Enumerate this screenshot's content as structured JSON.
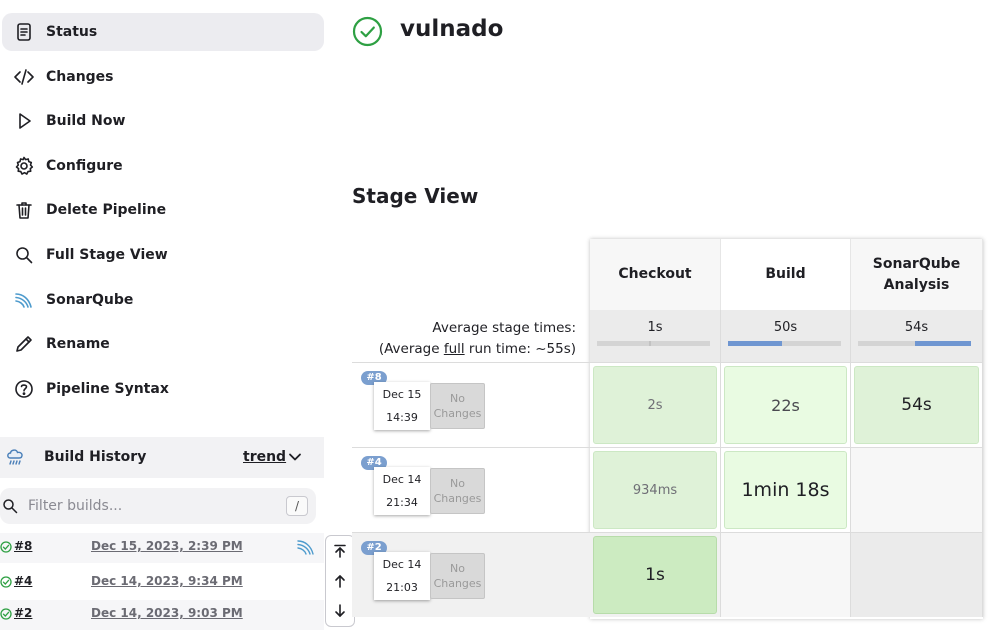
{
  "sidebar": {
    "tasks": [
      {
        "label": "Status",
        "icon": "status-icon",
        "active": true
      },
      {
        "label": "Changes",
        "icon": "code-icon"
      },
      {
        "label": "Build Now",
        "icon": "play-icon"
      },
      {
        "label": "Configure",
        "icon": "gear-icon"
      },
      {
        "label": "Delete Pipeline",
        "icon": "trash-icon"
      },
      {
        "label": "Full Stage View",
        "icon": "search-icon"
      },
      {
        "label": "SonarQube",
        "icon": "sonarqube-icon"
      },
      {
        "label": "Rename",
        "icon": "pencil-icon"
      },
      {
        "label": "Pipeline Syntax",
        "icon": "help-icon"
      }
    ]
  },
  "build_history": {
    "title": "Build History",
    "trend": "trend",
    "filter_placeholder": "Filter builds...",
    "filter_shortcut": "/",
    "builds": [
      {
        "number": "#8",
        "date": "Dec 15, 2023, 2:39 PM",
        "status": "success"
      },
      {
        "number": "#4",
        "date": "Dec 14, 2023, 9:34 PM",
        "status": "success"
      },
      {
        "number": "#2",
        "date": "Dec 14, 2023, 9:03 PM",
        "status": "success"
      }
    ]
  },
  "job": {
    "name": "vulnado",
    "status": "success"
  },
  "stage_view": {
    "title": "Stage View",
    "avg_label": "Average stage times:",
    "avg_full_prefix": "(Average ",
    "avg_full_link": "full",
    "avg_full_suffix": " run time: ~55s)",
    "stages": [
      {
        "name": "Checkout",
        "avg": "1s",
        "avg_fraction": 0.02
      },
      {
        "name": "Build",
        "avg": "50s",
        "avg_fraction": 0.48
      },
      {
        "name": "SonarQube Analysis",
        "avg": "54s",
        "avg_fraction": 0.5
      }
    ],
    "runs": [
      {
        "badge": "#8",
        "date": "Dec 15",
        "time": "14:39",
        "changes": "No Changes",
        "durations": [
          "2s",
          "22s",
          "54s"
        ]
      },
      {
        "badge": "#4",
        "date": "Dec 14",
        "time": "21:34",
        "changes": "No Changes",
        "durations": [
          "934ms",
          "1min 18s",
          ""
        ]
      },
      {
        "badge": "#2",
        "date": "Dec 14",
        "time": "21:03",
        "changes": "No Changes",
        "durations": [
          "1s",
          "",
          ""
        ]
      }
    ]
  },
  "colors": {
    "success": "#2ea043",
    "stage_fill": "#6f96d1",
    "cell_green": "#dff2d8",
    "badge": "#7b9fcf"
  }
}
